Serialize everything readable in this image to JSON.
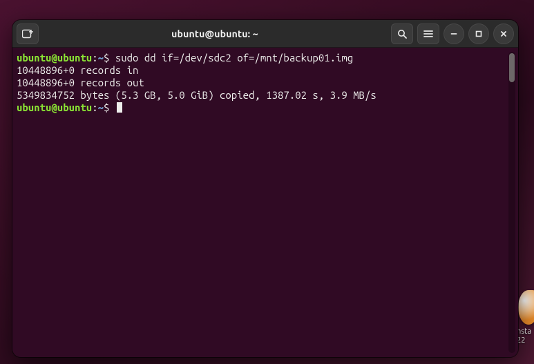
{
  "desktop": {
    "icon_label": "nsta\n22"
  },
  "window": {
    "title": "ubuntu@ubuntu: ~",
    "buttons": {
      "new_tab": "new-tab",
      "search": "search",
      "menu": "menu",
      "minimize": "minimize",
      "maximize": "maximize",
      "close": "close"
    }
  },
  "prompt": {
    "user_host": "ubuntu@ubuntu",
    "sep1": ":",
    "path": "~",
    "sigil": "$"
  },
  "session": {
    "command": "sudo dd if=/dev/sdc2 of=/mnt/backup01.img",
    "output": [
      "10448896+0 records in",
      "10448896+0 records out",
      "5349834752 bytes (5.3 GB, 5.0 GiB) copied, 1387.02 s, 3.9 MB/s"
    ]
  }
}
